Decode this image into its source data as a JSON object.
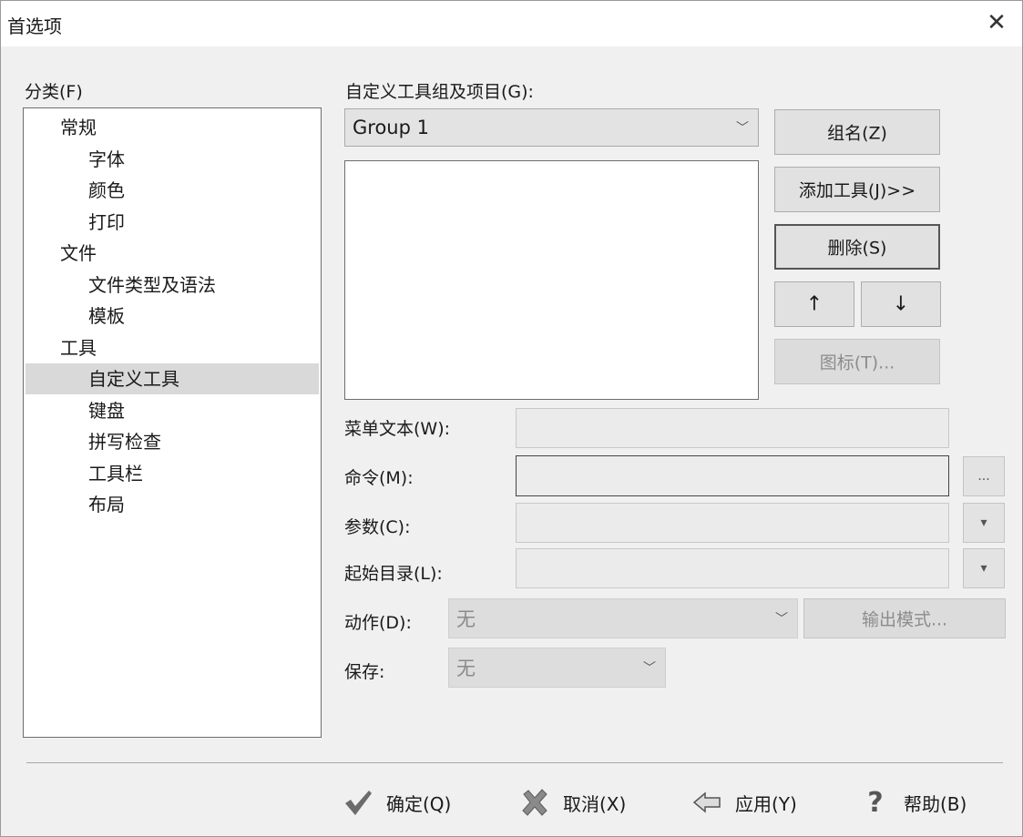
{
  "window": {
    "title": "首选项"
  },
  "category": {
    "label": "分类(F)",
    "items": [
      {
        "label": "常规",
        "level": 0
      },
      {
        "label": "字体",
        "level": 1
      },
      {
        "label": "颜色",
        "level": 1
      },
      {
        "label": "打印",
        "level": 1
      },
      {
        "label": "文件",
        "level": 0
      },
      {
        "label": "文件类型及语法",
        "level": 1
      },
      {
        "label": "模板",
        "level": 1
      },
      {
        "label": "工具",
        "level": 0
      },
      {
        "label": "自定义工具",
        "level": 1,
        "selected": true
      },
      {
        "label": "键盘",
        "level": 1
      },
      {
        "label": "拼写检查",
        "level": 1
      },
      {
        "label": "工具栏",
        "level": 1
      },
      {
        "label": "布局",
        "level": 1
      }
    ]
  },
  "tools": {
    "group_label": "自定义工具组及项目(G):",
    "group_value": "Group 1",
    "buttons": {
      "group_name": "组名(Z)",
      "add_tool": "添加工具(J)>>",
      "delete": "删除(S)",
      "up": "↑",
      "down": "↓",
      "icon": "图标(T)..."
    }
  },
  "fields": {
    "menu_text": "菜单文本(W):",
    "command": "命令(M):",
    "command_browse": "...",
    "args": "参数(C):",
    "start_dir": "起始目录(L):",
    "action": "动作(D):",
    "action_value": "无",
    "output_mode": "输出模式...",
    "save": "保存:",
    "save_value": "无"
  },
  "footer": {
    "ok": "确定(Q)",
    "cancel": "取消(X)",
    "apply": "应用(Y)",
    "help": "帮助(B)"
  },
  "colors": {
    "selection": "#d9d9d9",
    "ok_icon": "#6b6b6b"
  },
  "icons": [
    "close-icon",
    "chevron-down-icon",
    "checkmark-icon",
    "cross-icon",
    "left-arrow-icon",
    "question-icon"
  ]
}
